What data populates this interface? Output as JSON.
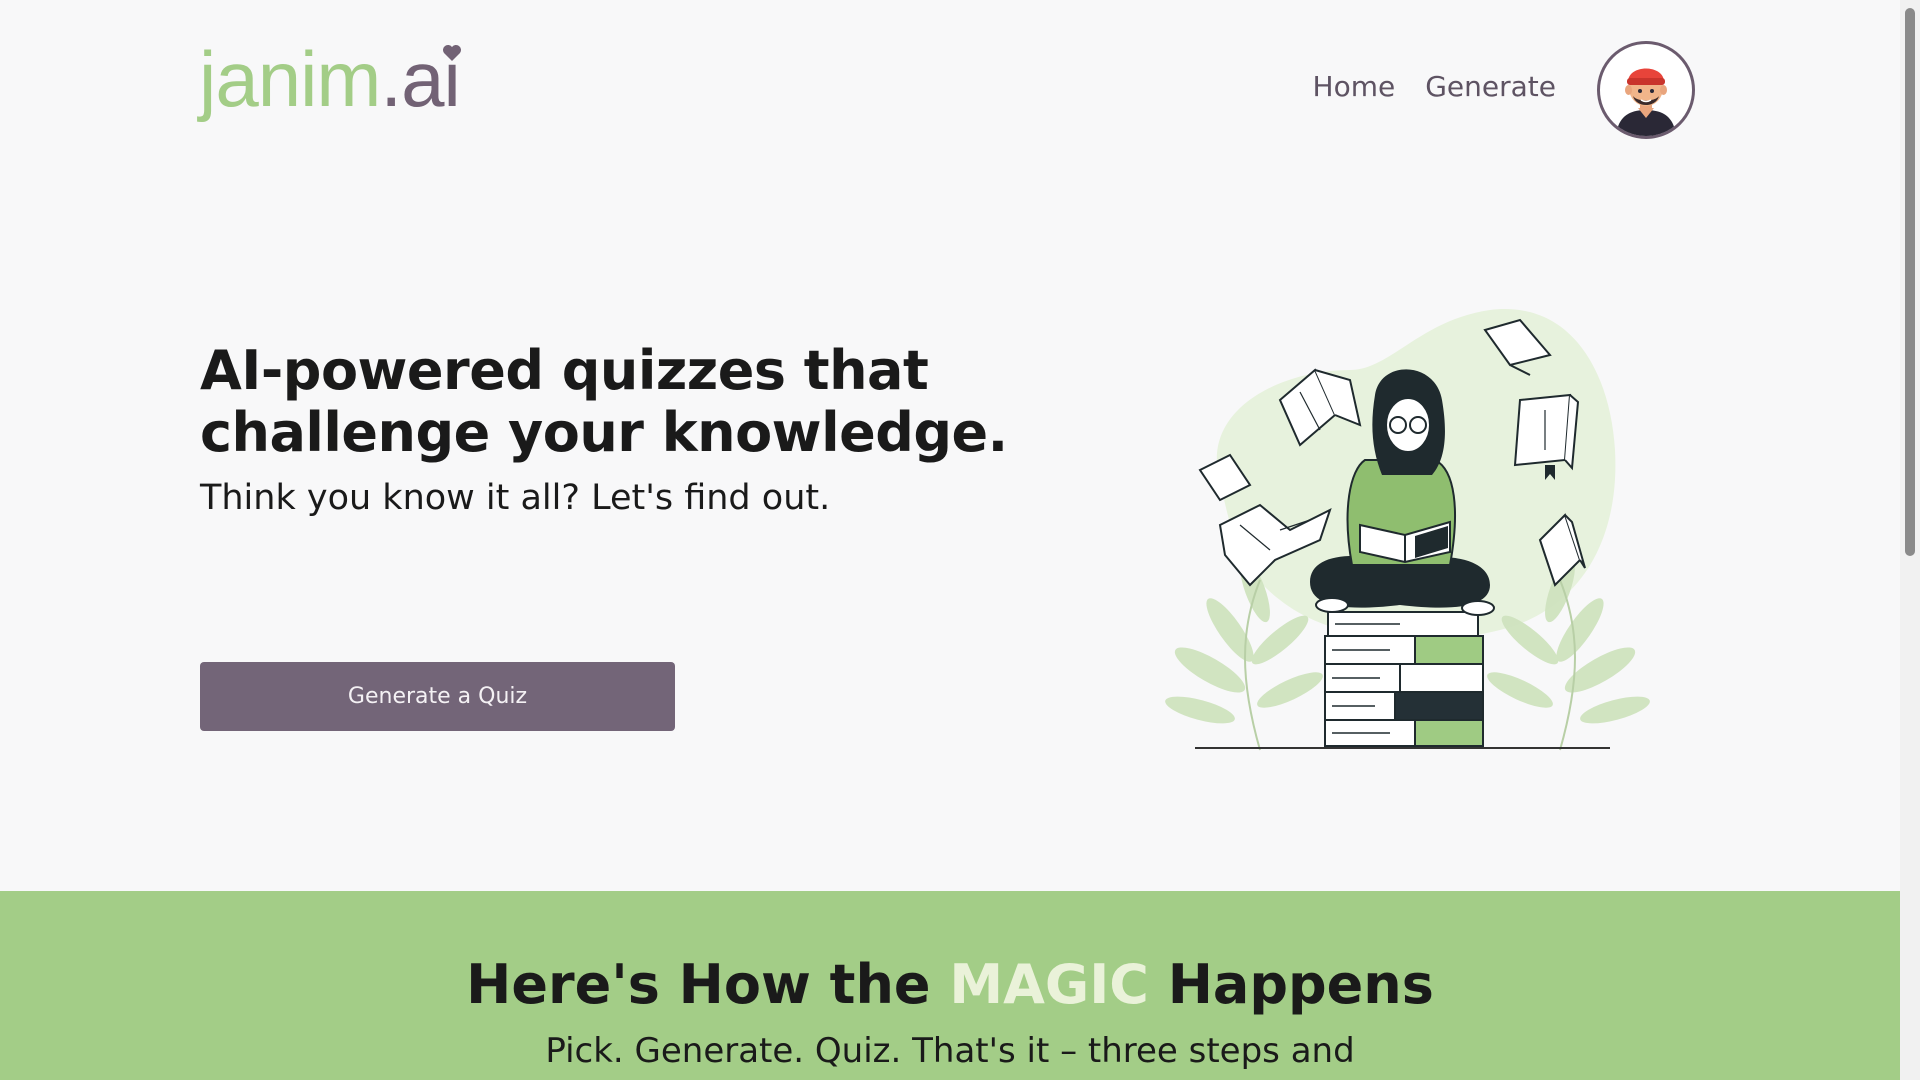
{
  "brand": {
    "part1": "janim",
    "part2": ".ai",
    "accent": "#a3cd87",
    "secondary": "#726275"
  },
  "nav": {
    "home": "Home",
    "generate": "Generate"
  },
  "avatar": {
    "icon": "user-avatar-icon"
  },
  "hero": {
    "title": "AI-powered quizzes that challenge your knowledge.",
    "subtitle": "Think you know it all? Let's find out.",
    "cta": "Generate a Quiz",
    "cta_color": "#736578"
  },
  "how": {
    "title_before": "Here's How the ",
    "title_highlight": "MAGIC",
    "title_after": " Happens",
    "subtitle": "Pick. Generate. Quiz. That's it – three steps and",
    "band_color": "#a3cd87"
  }
}
